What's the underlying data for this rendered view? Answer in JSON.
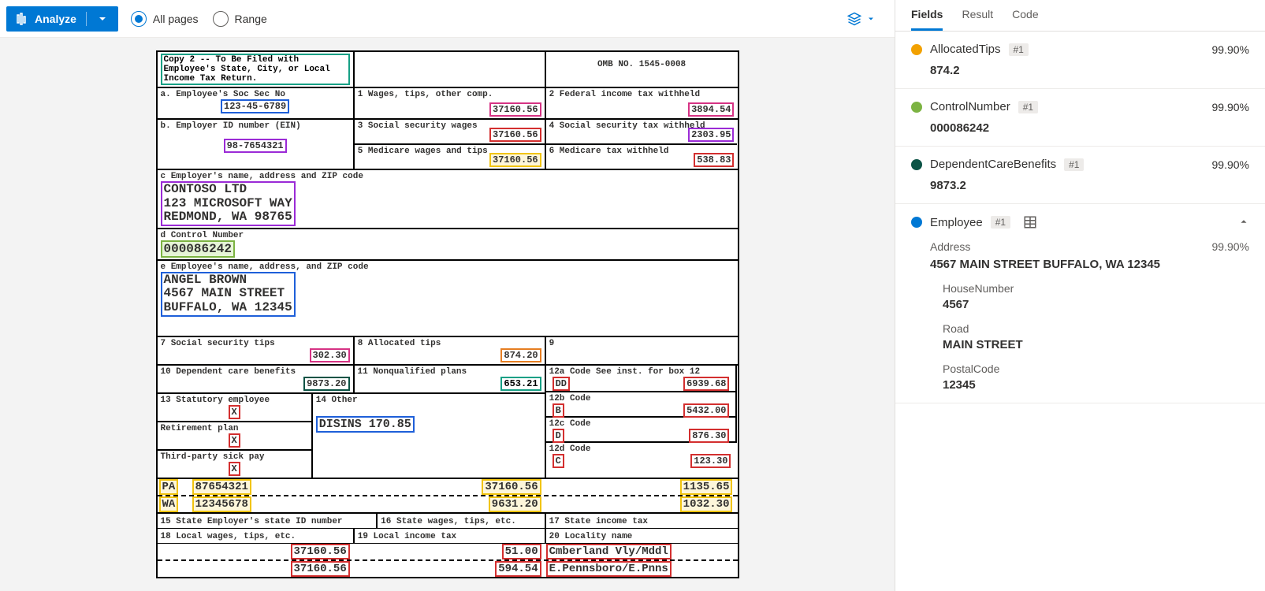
{
  "toolbar": {
    "analyze_label": "Analyze",
    "all_pages_label": "All pages",
    "range_label": "Range",
    "page_mode": "all"
  },
  "tabs": {
    "fields": "Fields",
    "result": "Result",
    "code": "Code",
    "active": "fields"
  },
  "w2": {
    "copy_notice": "Copy 2 -- To Be Filed with Employee's State, City, or Local Income Tax Return.",
    "omb": "OMB NO. 1545-0008",
    "labels": {
      "ssn": "a. Employee's Soc Sec No",
      "ein": "b. Employer ID number (EIN)",
      "box1": "1 Wages, tips, other comp.",
      "box2": "2 Federal income tax withheld",
      "box3": "3 Social security wages",
      "box4": "4 Social security tax withheld",
      "box5": "5 Medicare wages and tips",
      "box6": "6 Medicare tax withheld",
      "employer": "c Employer's name, address and ZIP code",
      "control": "d Control Number",
      "employee": "e Employee's name, address, and ZIP code",
      "box7": "7 Social security tips",
      "box8": "8 Allocated tips",
      "box9": "9",
      "box10": "10 Dependent care benefits",
      "box11": "11 Nonqualified plans",
      "box12a": "12a Code See inst. for box 12",
      "box12b": "12b Code",
      "box12c": "12c Code",
      "box12d": "12d Code",
      "box13stat": "13 Statutory employee",
      "box13ret": "Retirement plan",
      "box13sick": "Third-party sick pay",
      "box14": "14 Other",
      "box15": "15 State Employer's state ID number",
      "box16": "16 State wages, tips, etc.",
      "box17": "17 State income tax",
      "box18": "18 Local wages, tips, etc.",
      "box19": "19 Local income tax",
      "box20": "20 Locality name"
    },
    "values": {
      "ssn": "123-45-6789",
      "ein": "98-7654321",
      "box1": "37160.56",
      "box2": "3894.54",
      "box3": "37160.56",
      "box4": "2303.95",
      "box5": "37160.56",
      "box6": "538.83",
      "employer_line1": "CONTOSO LTD",
      "employer_line2": "123 MICROSOFT WAY",
      "employer_line3": "REDMOND, WA 98765",
      "control": "000086242",
      "employee_line1": "ANGEL BROWN",
      "employee_line2": "4567 MAIN STREET",
      "employee_line3": "BUFFALO, WA 12345",
      "box7": "302.30",
      "box8": "874.20",
      "box10": "9873.20",
      "box11": "653.21",
      "box12a_code": "DD",
      "box12a_amt": "6939.68",
      "box12b_code": "B",
      "box12b_amt": "5432.00",
      "box12c_code": "D",
      "box12c_amt": "876.30",
      "box12d_code": "C",
      "box12d_amt": "123.30",
      "box13stat": "X",
      "box13ret": "X",
      "box13sick": "X",
      "box14": "DISINS    170.85",
      "state1": "PA",
      "state1_id": "87654321",
      "state1_wages": "37160.56",
      "state1_tax": "1135.65",
      "state2": "WA",
      "state2_id": "12345678",
      "state2_wages": "9631.20",
      "state2_tax": "1032.30",
      "local1_wages": "37160.56",
      "local1_tax": "51.00",
      "local1_name": "Cmberland Vly/Mddl",
      "local2_wages": "37160.56",
      "local2_tax": "594.54",
      "local2_name": "E.Pennsboro/E.Pnns"
    }
  },
  "fields": [
    {
      "key": "allocatedtips",
      "dot": "#f2a100",
      "name": "AllocatedTips",
      "badge": "#1",
      "conf": "99.90%",
      "value": "874.2"
    },
    {
      "key": "controlnumber",
      "dot": "#7cb342",
      "name": "ControlNumber",
      "badge": "#1",
      "conf": "99.90%",
      "value": "000086242"
    },
    {
      "key": "dependentcare",
      "dot": "#0b5345",
      "name": "DependentCareBenefits",
      "badge": "#1",
      "conf": "99.90%",
      "value": "9873.2"
    }
  ],
  "employee_field": {
    "dot": "#0078d4",
    "name": "Employee",
    "badge": "#1",
    "address_label": "Address",
    "address_conf": "99.90%",
    "address_value": "4567 MAIN STREET BUFFALO, WA 12345",
    "sub": [
      {
        "label": "HouseNumber",
        "value": "4567"
      },
      {
        "label": "Road",
        "value": "MAIN STREET"
      },
      {
        "label": "PostalCode",
        "value": "12345"
      }
    ]
  }
}
